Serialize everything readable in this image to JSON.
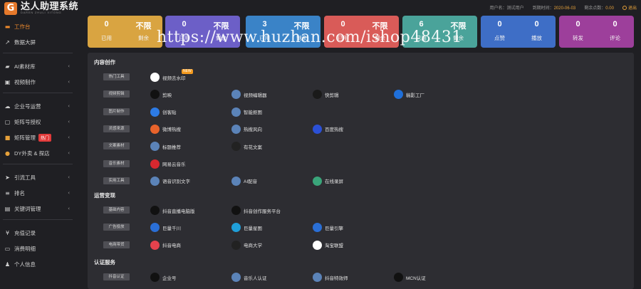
{
  "app": {
    "logo_letter": "G",
    "title": "达人助理系统",
    "subtitle": "DAREN ZHULI XITONG"
  },
  "header": {
    "username_label": "用户名：",
    "username_value": "测试用户",
    "expire_label": "到期时间：",
    "expire_value": "2020-06-03",
    "points_label": "剩余点数：",
    "points_value": "0.00",
    "logout_label": "退出"
  },
  "sidebar": {
    "items": [
      {
        "label": "工作台",
        "icon": "workbench-icon"
      },
      {
        "label": "数据大屏",
        "icon": "chart-icon"
      },
      {
        "label": "AI素材库",
        "icon": "folder-icon"
      },
      {
        "label": "视频制作",
        "icon": "video-icon"
      },
      {
        "label": "企业号运营",
        "icon": "cloud-icon"
      },
      {
        "label": "矩阵号授权",
        "icon": "authorize-icon"
      },
      {
        "label": "矩阵管理",
        "icon": "matrix-icon",
        "badge": "热门"
      },
      {
        "label": "DY外卖 & 探店",
        "icon": "delivery-icon"
      },
      {
        "label": "引流工具",
        "icon": "send-icon"
      },
      {
        "label": "排名",
        "icon": "rank-icon"
      },
      {
        "label": "关键词管理",
        "icon": "key-icon"
      },
      {
        "label": "充值记录",
        "icon": "yen-icon"
      },
      {
        "label": "消费明细",
        "icon": "receipt-icon"
      },
      {
        "label": "个人信息",
        "icon": "user-icon"
      }
    ]
  },
  "stats": [
    {
      "color": "#d9a441",
      "cols": [
        {
          "num": "0",
          "label": "已用"
        },
        {
          "num": "不限",
          "label": "剩余"
        }
      ]
    },
    {
      "color": "#6c5fc7",
      "cols": [
        {
          "num": "0",
          "label": "已用"
        },
        {
          "num": "不限",
          "label": "剩余"
        }
      ]
    },
    {
      "color": "#3a83c7",
      "cols": [
        {
          "num": "3",
          "label": "已用"
        },
        {
          "num": "不限",
          "label": "剩余"
        }
      ]
    },
    {
      "color": "#d95b58",
      "cols": [
        {
          "num": "0",
          "label": "已用"
        },
        {
          "num": "不限",
          "label": "剩余"
        }
      ]
    },
    {
      "color": "#4aa39a",
      "cols": [
        {
          "num": "6",
          "label": "已用"
        },
        {
          "num": "不限",
          "label": "剩余"
        }
      ]
    },
    {
      "color": "#3e6ec6",
      "cols": [
        {
          "num": "0",
          "label": "点赞"
        },
        {
          "num": "0",
          "label": "播放"
        }
      ]
    },
    {
      "color": "#9d3f9b",
      "cols": [
        {
          "num": "0",
          "label": "转发"
        },
        {
          "num": "0",
          "label": "评论"
        }
      ]
    }
  ],
  "watermark": "https://www.huzhan.com/ishop48431",
  "sections": [
    {
      "title": "内容创作",
      "rows": [
        {
          "tag": "热门工具",
          "tools": [
            {
              "label": "视频去水印",
              "icon": "watermark-remove-icon",
              "color": "#ffffff",
              "badge": "NEW"
            }
          ]
        },
        {
          "tag": "视频剪辑",
          "tools": [
            {
              "label": "剪映",
              "icon": "capcut-icon",
              "color": "#111111"
            },
            {
              "label": "视频编辑器",
              "icon": "app-icon",
              "color": "#5b83b8"
            },
            {
              "label": "快剪辑",
              "icon": "kuaijianji-icon",
              "color": "#1a1a1a"
            },
            {
              "label": "稿影工厂",
              "icon": "film-factory-icon",
              "color": "#1f6fd9"
            }
          ]
        },
        {
          "tag": "图片制作",
          "tools": [
            {
              "label": "创客贴",
              "icon": "chuangketie-icon",
              "color": "#2d7be5"
            },
            {
              "label": "智能抠图",
              "icon": "app-icon",
              "color": "#5b83b8"
            }
          ]
        },
        {
          "tag": "灵感来源",
          "tools": [
            {
              "label": "微博热搜",
              "icon": "weibo-icon",
              "color": "#e8632b"
            },
            {
              "label": "热搜风向",
              "icon": "app-icon",
              "color": "#5b83b8"
            },
            {
              "label": "百度热搜",
              "icon": "baidu-icon",
              "color": "#2b50d6"
            }
          ]
        },
        {
          "tag": "文案素材",
          "tools": [
            {
              "label": "标题推荐",
              "icon": "app-icon",
              "color": "#5b83b8"
            },
            {
              "label": "有花文案",
              "icon": "flower-icon",
              "color": "#222222"
            }
          ]
        },
        {
          "tag": "音乐素材",
          "tools": [
            {
              "label": "网易云音乐",
              "icon": "netease-music-icon",
              "color": "#d7282f"
            }
          ]
        },
        {
          "tag": "实用工具",
          "tools": [
            {
              "label": "语音识别文字",
              "icon": "app-icon",
              "color": "#5b83b8"
            },
            {
              "label": "AI配音",
              "icon": "app-icon",
              "color": "#5b83b8"
            },
            {
              "label": "在线录屏",
              "icon": "record-icon",
              "color": "#3aa57a"
            }
          ]
        }
      ]
    },
    {
      "title": "运营变现",
      "rows": [
        {
          "tag": "基础内容",
          "tools": [
            {
              "label": "抖音直播电脑版",
              "icon": "douyin-icon",
              "color": "#111111"
            },
            {
              "label": "抖音创作服务平台",
              "icon": "douyin-icon",
              "color": "#111111"
            }
          ]
        },
        {
          "tag": "广告投放",
          "tools": [
            {
              "label": "巨量千川",
              "icon": "qianchuan-icon",
              "color": "#2a6fd6"
            },
            {
              "label": "巨量星图",
              "icon": "xingtu-icon",
              "color": "#1f9fd9"
            },
            {
              "label": "巨量引擎",
              "icon": "engine-icon",
              "color": "#2a6fd6"
            }
          ]
        },
        {
          "tag": "电商带货",
          "tools": [
            {
              "label": "抖音电商",
              "icon": "douyin-shop-icon",
              "color": "#e5424d"
            },
            {
              "label": "电商大学",
              "icon": "graduation-icon",
              "color": "#222222"
            },
            {
              "label": "淘宝联盟",
              "icon": "taobao-union-icon",
              "color": "#ffffff"
            }
          ]
        }
      ]
    },
    {
      "title": "认证服务",
      "rows": [
        {
          "tag": "抖音认证",
          "tools": [
            {
              "label": "企业号",
              "icon": "douyin-icon",
              "color": "#111111"
            },
            {
              "label": "音乐人认证",
              "icon": "app-icon",
              "color": "#5b83b8"
            },
            {
              "label": "抖音特效师",
              "icon": "app-icon",
              "color": "#5b83b8"
            },
            {
              "label": "MCN认证",
              "icon": "mcn-icon",
              "color": "#111111"
            }
          ]
        }
      ]
    }
  ]
}
